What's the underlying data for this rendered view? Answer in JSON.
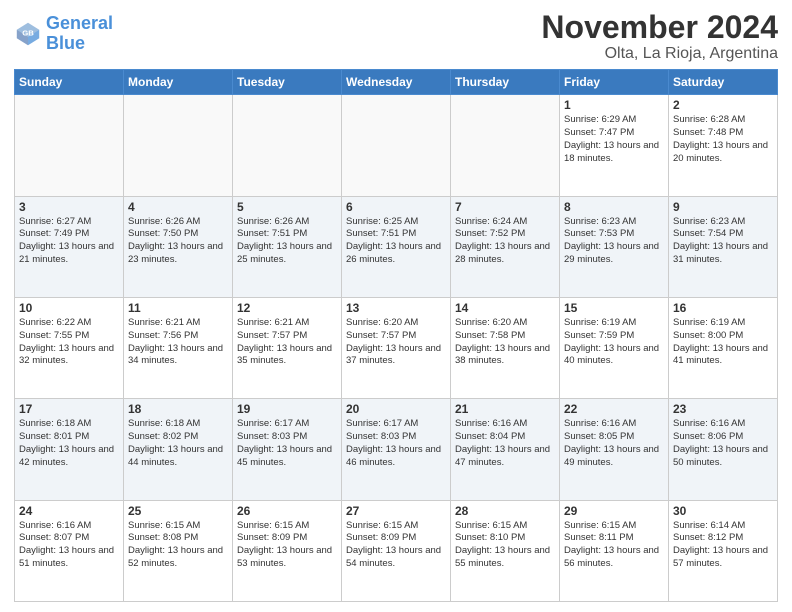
{
  "logo": {
    "line1": "General",
    "line2": "Blue"
  },
  "title": "November 2024",
  "subtitle": "Olta, La Rioja, Argentina",
  "days_of_week": [
    "Sunday",
    "Monday",
    "Tuesday",
    "Wednesday",
    "Thursday",
    "Friday",
    "Saturday"
  ],
  "weeks": [
    [
      {
        "day": "",
        "info": ""
      },
      {
        "day": "",
        "info": ""
      },
      {
        "day": "",
        "info": ""
      },
      {
        "day": "",
        "info": ""
      },
      {
        "day": "",
        "info": ""
      },
      {
        "day": "1",
        "info": "Sunrise: 6:29 AM\nSunset: 7:47 PM\nDaylight: 13 hours and 18 minutes."
      },
      {
        "day": "2",
        "info": "Sunrise: 6:28 AM\nSunset: 7:48 PM\nDaylight: 13 hours and 20 minutes."
      }
    ],
    [
      {
        "day": "3",
        "info": "Sunrise: 6:27 AM\nSunset: 7:49 PM\nDaylight: 13 hours and 21 minutes."
      },
      {
        "day": "4",
        "info": "Sunrise: 6:26 AM\nSunset: 7:50 PM\nDaylight: 13 hours and 23 minutes."
      },
      {
        "day": "5",
        "info": "Sunrise: 6:26 AM\nSunset: 7:51 PM\nDaylight: 13 hours and 25 minutes."
      },
      {
        "day": "6",
        "info": "Sunrise: 6:25 AM\nSunset: 7:51 PM\nDaylight: 13 hours and 26 minutes."
      },
      {
        "day": "7",
        "info": "Sunrise: 6:24 AM\nSunset: 7:52 PM\nDaylight: 13 hours and 28 minutes."
      },
      {
        "day": "8",
        "info": "Sunrise: 6:23 AM\nSunset: 7:53 PM\nDaylight: 13 hours and 29 minutes."
      },
      {
        "day": "9",
        "info": "Sunrise: 6:23 AM\nSunset: 7:54 PM\nDaylight: 13 hours and 31 minutes."
      }
    ],
    [
      {
        "day": "10",
        "info": "Sunrise: 6:22 AM\nSunset: 7:55 PM\nDaylight: 13 hours and 32 minutes."
      },
      {
        "day": "11",
        "info": "Sunrise: 6:21 AM\nSunset: 7:56 PM\nDaylight: 13 hours and 34 minutes."
      },
      {
        "day": "12",
        "info": "Sunrise: 6:21 AM\nSunset: 7:57 PM\nDaylight: 13 hours and 35 minutes."
      },
      {
        "day": "13",
        "info": "Sunrise: 6:20 AM\nSunset: 7:57 PM\nDaylight: 13 hours and 37 minutes."
      },
      {
        "day": "14",
        "info": "Sunrise: 6:20 AM\nSunset: 7:58 PM\nDaylight: 13 hours and 38 minutes."
      },
      {
        "day": "15",
        "info": "Sunrise: 6:19 AM\nSunset: 7:59 PM\nDaylight: 13 hours and 40 minutes."
      },
      {
        "day": "16",
        "info": "Sunrise: 6:19 AM\nSunset: 8:00 PM\nDaylight: 13 hours and 41 minutes."
      }
    ],
    [
      {
        "day": "17",
        "info": "Sunrise: 6:18 AM\nSunset: 8:01 PM\nDaylight: 13 hours and 42 minutes."
      },
      {
        "day": "18",
        "info": "Sunrise: 6:18 AM\nSunset: 8:02 PM\nDaylight: 13 hours and 44 minutes."
      },
      {
        "day": "19",
        "info": "Sunrise: 6:17 AM\nSunset: 8:03 PM\nDaylight: 13 hours and 45 minutes."
      },
      {
        "day": "20",
        "info": "Sunrise: 6:17 AM\nSunset: 8:03 PM\nDaylight: 13 hours and 46 minutes."
      },
      {
        "day": "21",
        "info": "Sunrise: 6:16 AM\nSunset: 8:04 PM\nDaylight: 13 hours and 47 minutes."
      },
      {
        "day": "22",
        "info": "Sunrise: 6:16 AM\nSunset: 8:05 PM\nDaylight: 13 hours and 49 minutes."
      },
      {
        "day": "23",
        "info": "Sunrise: 6:16 AM\nSunset: 8:06 PM\nDaylight: 13 hours and 50 minutes."
      }
    ],
    [
      {
        "day": "24",
        "info": "Sunrise: 6:16 AM\nSunset: 8:07 PM\nDaylight: 13 hours and 51 minutes."
      },
      {
        "day": "25",
        "info": "Sunrise: 6:15 AM\nSunset: 8:08 PM\nDaylight: 13 hours and 52 minutes."
      },
      {
        "day": "26",
        "info": "Sunrise: 6:15 AM\nSunset: 8:09 PM\nDaylight: 13 hours and 53 minutes."
      },
      {
        "day": "27",
        "info": "Sunrise: 6:15 AM\nSunset: 8:09 PM\nDaylight: 13 hours and 54 minutes."
      },
      {
        "day": "28",
        "info": "Sunrise: 6:15 AM\nSunset: 8:10 PM\nDaylight: 13 hours and 55 minutes."
      },
      {
        "day": "29",
        "info": "Sunrise: 6:15 AM\nSunset: 8:11 PM\nDaylight: 13 hours and 56 minutes."
      },
      {
        "day": "30",
        "info": "Sunrise: 6:14 AM\nSunset: 8:12 PM\nDaylight: 13 hours and 57 minutes."
      }
    ]
  ]
}
